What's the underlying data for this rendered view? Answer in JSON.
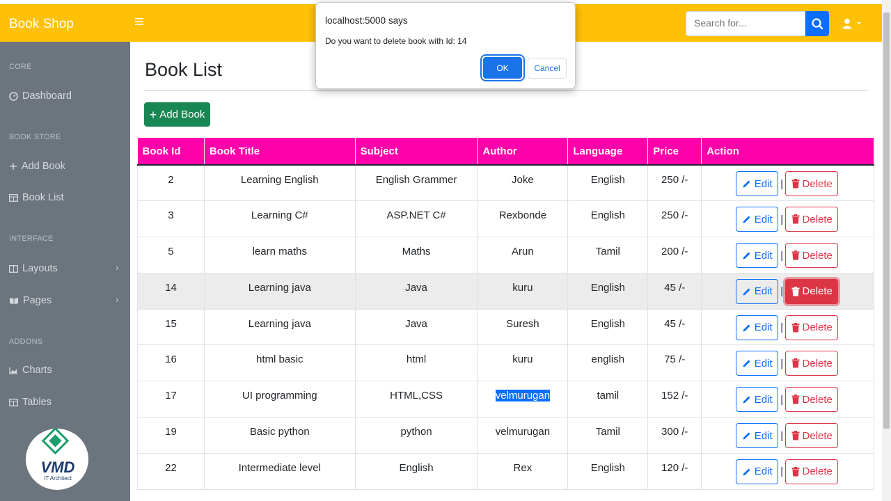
{
  "navbar": {
    "brand": "Book Shop",
    "search_placeholder": "Search for..."
  },
  "sidebar": {
    "sections": [
      {
        "heading": "CORE",
        "items": [
          {
            "label": "Dashboard",
            "icon": "gauge-icon"
          }
        ]
      },
      {
        "heading": "BOOK STORE",
        "items": [
          {
            "label": "Add Book",
            "icon": "plus-icon"
          },
          {
            "label": "Book List",
            "icon": "table-icon"
          }
        ]
      },
      {
        "heading": "INTERFACE",
        "items": [
          {
            "label": "Layouts",
            "icon": "columns-icon"
          },
          {
            "label": "Pages",
            "icon": "book-open-icon"
          }
        ]
      },
      {
        "heading": "ADDONS",
        "items": [
          {
            "label": "Charts",
            "icon": "chart-area-icon"
          },
          {
            "label": "Tables",
            "icon": "table-icon"
          }
        ]
      }
    ]
  },
  "logo": {
    "text": "VMD",
    "subtitle": "IT Architect"
  },
  "page": {
    "title": "Book List",
    "add_button": "Add Book"
  },
  "table": {
    "headers": [
      "Book Id",
      "Book Title",
      "Subject",
      "Author",
      "Language",
      "Price",
      "Action"
    ],
    "edit_label": "Edit",
    "delete_label": "Delete",
    "separator": "|",
    "rows": [
      {
        "id": "2",
        "title": "Learning English",
        "subject": "English Grammer",
        "author": "Joke",
        "language": "English",
        "price": "250 /-"
      },
      {
        "id": "3",
        "title": "Learning C#",
        "subject": "ASP.NET C#",
        "author": "Rexbonde",
        "language": "English",
        "price": "250 /-"
      },
      {
        "id": "5",
        "title": "learn maths",
        "subject": "Maths",
        "author": "Arun",
        "language": "Tamil",
        "price": "200 /-"
      },
      {
        "id": "14",
        "title": "Learning java",
        "subject": "Java",
        "author": "kuru",
        "language": "English",
        "price": "45 /-"
      },
      {
        "id": "15",
        "title": "Learning java",
        "subject": "Java",
        "author": "Suresh",
        "language": "English",
        "price": "45 /-"
      },
      {
        "id": "16",
        "title": "html basic",
        "subject": "html",
        "author": "kuru",
        "language": "english",
        "price": "75 /-"
      },
      {
        "id": "17",
        "title": "UI programming",
        "subject": "HTML,CSS",
        "author": "velmurugan",
        "language": "tamil",
        "price": "152 /-"
      },
      {
        "id": "19",
        "title": "Basic python",
        "subject": "python",
        "author": "velmurugan",
        "language": "Tamil",
        "price": "300 /-"
      },
      {
        "id": "22",
        "title": "Intermediate level",
        "subject": "English",
        "author": "Rex",
        "language": "English",
        "price": "120 /-"
      }
    ]
  },
  "dialog": {
    "title": "localhost:5000 says",
    "message": "Do you want to delete book with Id: 14",
    "ok": "OK",
    "cancel": "Cancel"
  },
  "colors": {
    "navbar": "#ffc107",
    "sidebar": "#6c757d",
    "table_header": "#ff00aa",
    "add_button": "#198754",
    "edit": "#0d6efd",
    "delete": "#dc3545"
  }
}
